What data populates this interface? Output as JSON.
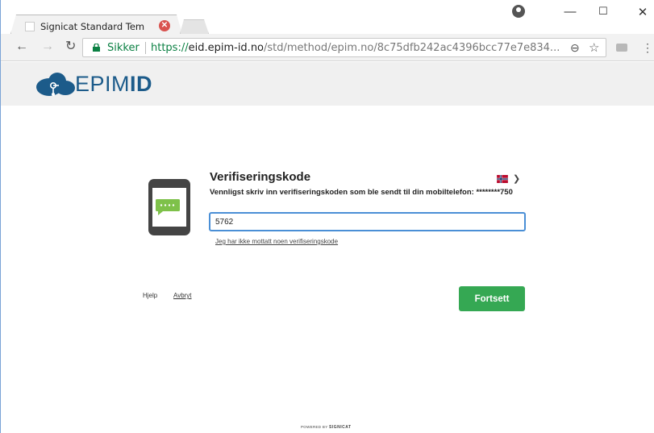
{
  "browser": {
    "tab_title": "Signicat Standard Templa",
    "secure_label": "Sikker",
    "url_scheme": "https://",
    "url_host": "eid.epim-id.no",
    "url_path": "/std/method/epim.no/8c75dfb242ac4396bcc77e7e834..."
  },
  "header": {
    "logo_text_light": "EPIM",
    "logo_text_bold": "ID"
  },
  "form": {
    "title": "Verifiseringskode",
    "instruction": "Vennligst skriv inn verifiseringskoden som ble sendt til din mobiltelefon: ********750",
    "code_value": "5762",
    "no_code_link": "Jeg har ikke mottatt noen verifiseringskode",
    "help_label": "Hjelp",
    "cancel_label": "Avbryt",
    "continue_label": "Fortsett"
  },
  "footer": {
    "powered_by": "POWERED BY",
    "brand": "SIGNICAT"
  },
  "colors": {
    "accent_button": "#35a853",
    "input_focus": "#4a8fd6",
    "logo_blue": "#1c5b8a"
  }
}
